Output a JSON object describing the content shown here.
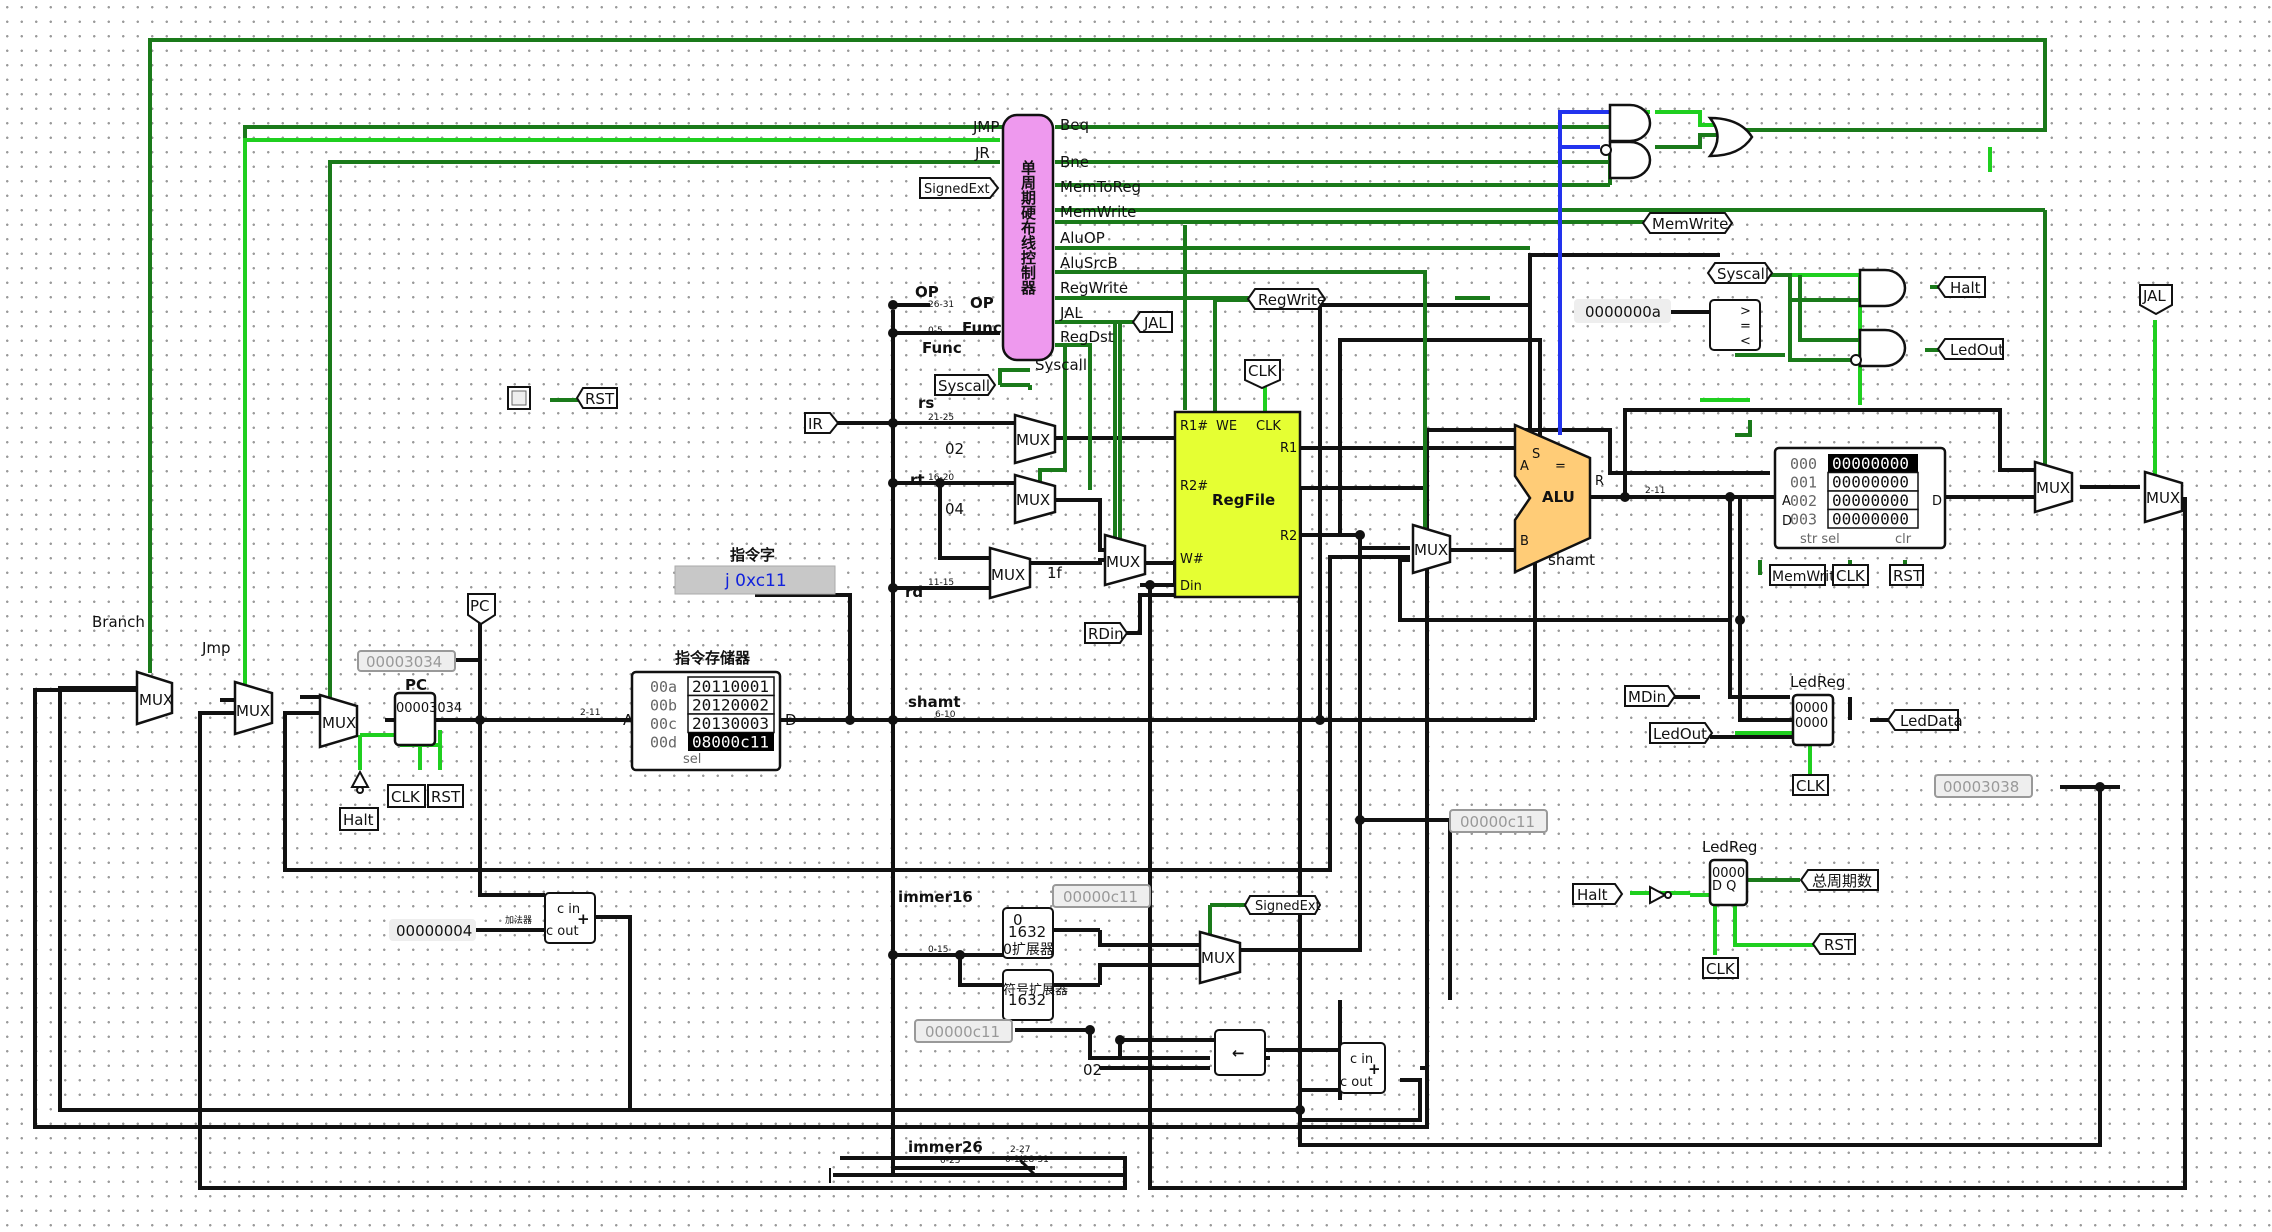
{
  "controller": {
    "title": "单周期硬布线控制器"
  },
  "ctrl_outputs_left": [
    "JMP",
    "JR",
    "OP",
    "Func"
  ],
  "ctrl_outputs_right": [
    "Beq",
    "Bne",
    "MemToReg",
    "MemWrite",
    "AluOP",
    "AluSrcB",
    "RegWrite",
    "JAL",
    "RegDst",
    "Syscall"
  ],
  "tunnels": {
    "signedext": "SignedExt",
    "memwrite": "MemWrite",
    "regwrite": "RegWrite",
    "jal": "JAL",
    "syscall": "Syscall",
    "halt": "Halt",
    "ledout": "LedOut",
    "rst": "RST",
    "clk": "CLK",
    "ir": "IR",
    "pc": "PC",
    "rdin": "RDin",
    "mdin": "MDin",
    "leddata": "LedData",
    "total_cycles": "总周期数"
  },
  "labels": {
    "branch": "Branch",
    "jmp": "Jmp",
    "pc": "PC",
    "inst_mem": "指令存储器",
    "inst_word": "指令字",
    "inst_text": "j 0xc11",
    "regfile": "RegFile",
    "alu": "ALU",
    "rs": "rs",
    "rt": "rt",
    "rd": "rd",
    "shamt": "shamt",
    "immer16": "immer16",
    "immer26": "immer26",
    "mux": "MUX",
    "ledreg": "LedReg",
    "adder": "加法器",
    "ext0": "0扩展器",
    "ext_sign": "符号扩展器",
    "bits_1632": "1632"
  },
  "values": {
    "pc_probe": "00003034",
    "const4": "00000004",
    "const_0a": "0000000a",
    "probe_c11_a": "00000c11",
    "probe_c11_b": "00000c11",
    "probe_c11_c": "00000c11",
    "probe_3038": "00003038",
    "const_02a": "02",
    "const_04": "04",
    "const_1f": "1f",
    "const_02b": "02",
    "pc_reg": "00003034"
  },
  "inst_mem": {
    "rows": [
      {
        "addr": "00a",
        "val": "20110001"
      },
      {
        "addr": "00b",
        "val": "20120002"
      },
      {
        "addr": "00c",
        "val": "20130003"
      },
      {
        "addr": "00d",
        "val": "08000c11",
        "selected": true
      }
    ]
  },
  "data_mem": {
    "rows": [
      {
        "addr": "000",
        "val": "00000000",
        "selected": true
      },
      {
        "addr": "001",
        "val": "00000000"
      },
      {
        "addr": "002",
        "val": "00000000"
      },
      {
        "addr": "003",
        "val": "00000000"
      }
    ]
  },
  "bit_ranges": {
    "op": "26-31",
    "func": "0-5",
    "rs": "21-25",
    "rt": "16-20",
    "rd": "11-15",
    "shamt": "6-10",
    "imm16": "0-15",
    "imm26": "0-25",
    "pc_split": "2-11",
    "alu_split": "2-11"
  }
}
